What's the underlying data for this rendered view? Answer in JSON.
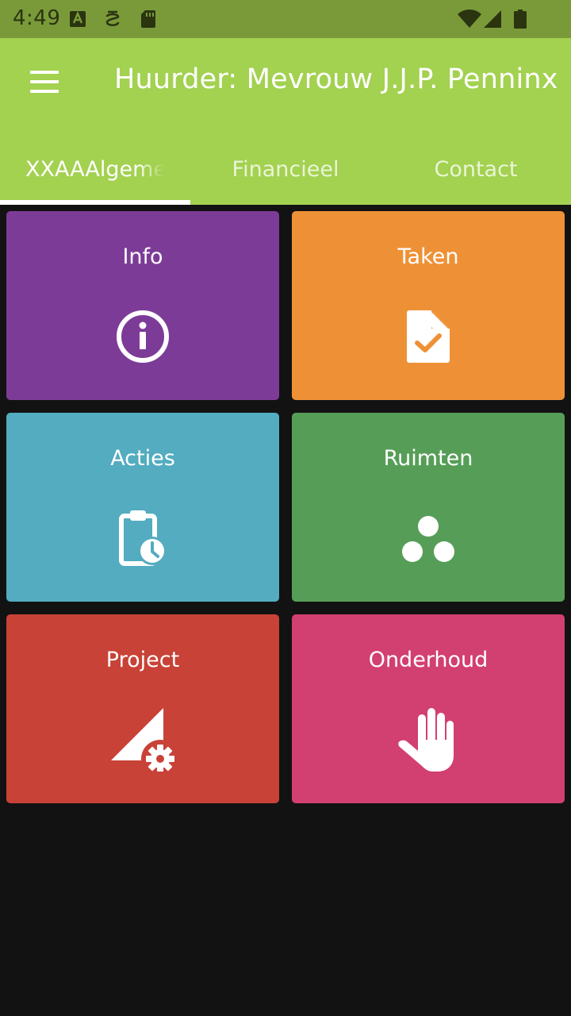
{
  "status": {
    "time": "4:49",
    "icons": [
      "text-a-notification-icon",
      "debug-bracket-icon",
      "sd-card-icon",
      "wifi-icon",
      "cell-signal-icon",
      "battery-icon"
    ]
  },
  "appbar": {
    "menu_icon": "hamburger-menu-icon",
    "title": "Huurder: Mevrouw J.J.P. Penninx"
  },
  "tabs": [
    {
      "label": "XXAAAlgemeen",
      "active": true
    },
    {
      "label": "Financieel",
      "active": false
    },
    {
      "label": "Contact",
      "active": false
    }
  ],
  "tiles": [
    {
      "label": "Info",
      "icon": "info-circle-icon",
      "color": "#7d3b98"
    },
    {
      "label": "Taken",
      "icon": "file-check-icon",
      "color": "#ee9136"
    },
    {
      "label": "Acties",
      "icon": "clipboard-clock-icon",
      "color": "#53acbf"
    },
    {
      "label": "Ruimten",
      "icon": "three-dots-icon",
      "color": "#569e57"
    },
    {
      "label": "Project",
      "icon": "triangle-gear-icon",
      "color": "#c84237"
    },
    {
      "label": "Onderhoud",
      "icon": "hand-stop-icon",
      "color": "#d23f71"
    }
  ],
  "colors": {
    "statusbar": "#7a9a3a",
    "appbar": "#a3d150",
    "background": "#121212"
  }
}
